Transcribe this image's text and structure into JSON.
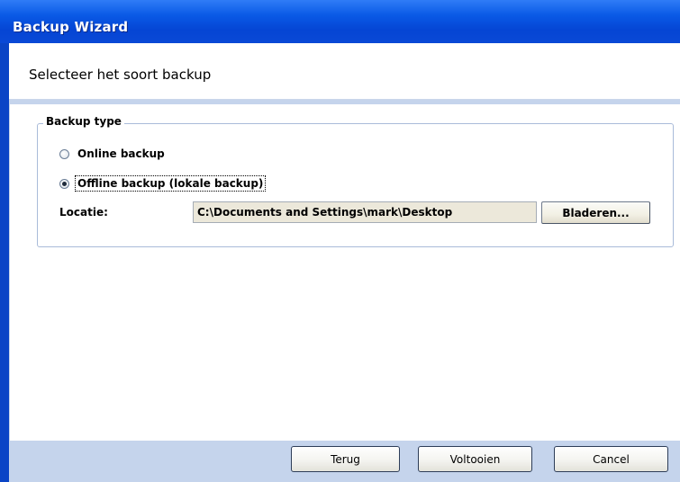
{
  "window": {
    "title": "Backup Wizard"
  },
  "header": {
    "title": "Selecteer het soort backup"
  },
  "backup_type": {
    "legend": "Backup type",
    "options": [
      {
        "label": "Online backup",
        "selected": false
      },
      {
        "label": "Offline backup (lokale backup)",
        "selected": true
      }
    ],
    "location_label": "Locatie:",
    "location_value": "C:\\Documents and Settings\\mark\\Desktop",
    "browse_label": "Bladeren..."
  },
  "footer": {
    "back_label": "Terug",
    "finish_label": "Voltooien",
    "cancel_label": "Cancel"
  },
  "colors": {
    "titlebar": "#0a5ae6",
    "footer": "#c5d4ec",
    "field_background": "#ece8da"
  }
}
